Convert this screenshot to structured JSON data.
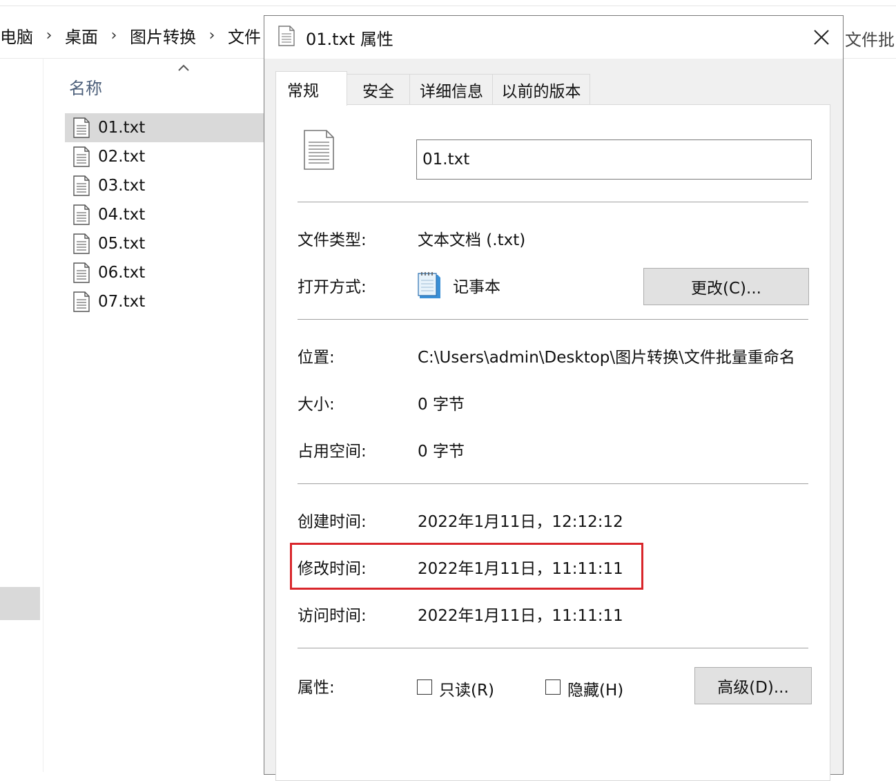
{
  "explorer": {
    "breadcrumb": [
      "电脑",
      "桌面",
      "图片转换",
      "文件"
    ],
    "right_crumb": "文件批",
    "column_name": "名称",
    "files": [
      "01.txt",
      "02.txt",
      "03.txt",
      "04.txt",
      "05.txt",
      "06.txt",
      "07.txt"
    ],
    "selected_file": "01.txt"
  },
  "dialog": {
    "title": "01.txt 属性",
    "tabs": [
      "常规",
      "安全",
      "详细信息",
      "以前的版本"
    ],
    "active_tab": "常规",
    "filename": "01.txt",
    "file_type_label": "文件类型:",
    "file_type_value": "文本文档 (.txt)",
    "open_with_label": "打开方式:",
    "open_with_app": "记事本",
    "change_button": "更改(C)...",
    "location_label": "位置:",
    "location_value": "C:\\Users\\admin\\Desktop\\图片转换\\文件批量重命名",
    "size_label": "大小:",
    "size_value": "0 字节",
    "size_on_disk_label": "占用空间:",
    "size_on_disk_value": "0 字节",
    "created_label": "创建时间:",
    "created_value": "2022年1月11日，12:12:12",
    "modified_label": "修改时间:",
    "modified_value": "2022年1月11日，11:11:11",
    "accessed_label": "访问时间:",
    "accessed_value": "2022年1月11日，11:11:11",
    "attributes_label": "属性:",
    "readonly_label": "只读(R)",
    "hidden_label": "隐藏(H)",
    "readonly_checked": false,
    "hidden_checked": false,
    "advanced_button": "高级(D)..."
  },
  "colors": {
    "highlight": "#d9262b",
    "selection": "#d9d9d9",
    "dialog_bg": "#f0f0f0",
    "button_bg": "#e1e1e1"
  }
}
